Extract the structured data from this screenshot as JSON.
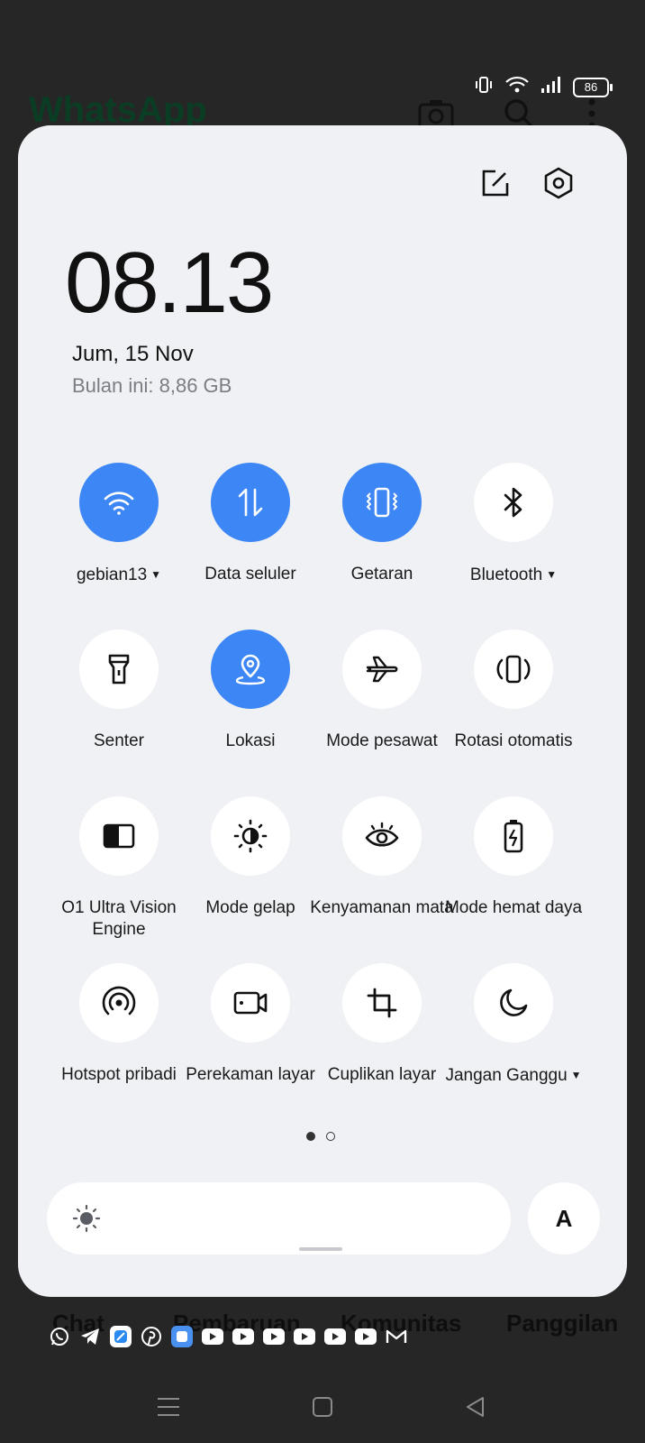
{
  "background_app": {
    "title": "WhatsApp",
    "tabs": [
      "Chat",
      "Pembaruan",
      "Komunitas",
      "Panggilan"
    ]
  },
  "status_bar": {
    "battery": "86"
  },
  "panel": {
    "clock": "08.13",
    "date": "Jum, 15 Nov",
    "usage": "Bulan ini: 8,86 GB"
  },
  "tiles": [
    {
      "label": "gebian13",
      "icon": "wifi-icon",
      "on": true,
      "caret": true
    },
    {
      "label": "Data seluler",
      "icon": "mobile-data-icon",
      "on": true,
      "caret": false
    },
    {
      "label": "Getaran",
      "icon": "vibrate-icon",
      "on": true,
      "caret": false
    },
    {
      "label": "Bluetooth",
      "icon": "bluetooth-icon",
      "on": false,
      "caret": true
    },
    {
      "label": "Senter",
      "icon": "flashlight-icon",
      "on": false,
      "caret": false
    },
    {
      "label": "Lokasi",
      "icon": "location-icon",
      "on": true,
      "caret": false
    },
    {
      "label": "Mode pesawat",
      "icon": "airplane-icon",
      "on": false,
      "caret": false
    },
    {
      "label": "Rotasi otomatis",
      "icon": "auto-rotate-icon",
      "on": false,
      "caret": false
    },
    {
      "label": "O1 Ultra Vision Engine",
      "icon": "vision-engine-icon",
      "on": false,
      "caret": false
    },
    {
      "label": "Mode gelap",
      "icon": "dark-mode-icon",
      "on": false,
      "caret": false
    },
    {
      "label": "Kenyamanan mata",
      "icon": "eye-comfort-icon",
      "on": false,
      "caret": false
    },
    {
      "label": "Mode hemat daya",
      "icon": "battery-saver-icon",
      "on": false,
      "caret": false
    },
    {
      "label": "Hotspot pribadi",
      "icon": "hotspot-icon",
      "on": false,
      "caret": false
    },
    {
      "label": "Perekaman layar",
      "icon": "screen-record-icon",
      "on": false,
      "caret": false
    },
    {
      "label": "Cuplikan layar",
      "icon": "screenshot-icon",
      "on": false,
      "caret": false
    },
    {
      "label": "Jangan Ganggu",
      "icon": "do-not-disturb-icon",
      "on": false,
      "caret": true
    }
  ],
  "brightness": {
    "auto_label": "A"
  },
  "colors": {
    "accent": "#3d86f5",
    "panel_bg": "#eff1f5"
  }
}
